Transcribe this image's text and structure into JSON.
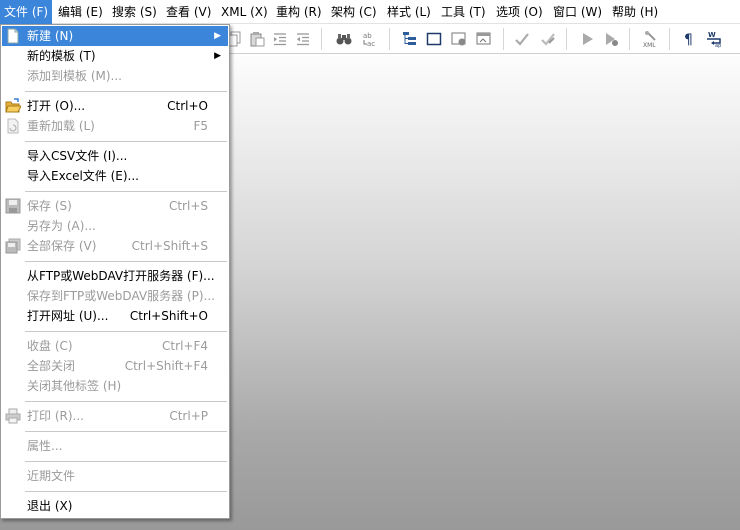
{
  "menubar": {
    "items": [
      "文件 (F)",
      "编辑 (E)",
      "搜索 (S)",
      "查看 (V)",
      "XML (X)",
      "重构 (R)",
      "架构 (C)",
      "样式 (L)",
      "工具 (T)",
      "选项 (O)",
      "窗口 (W)",
      "帮助 (H)"
    ]
  },
  "toolbar": {
    "icons": [
      "copy-icon",
      "paste-icon",
      "indent-icon",
      "outdent-icon",
      "find-icon",
      "replace-icon",
      "tree-view-icon",
      "text-view-icon",
      "grid-view-icon",
      "browser-view-icon",
      "check-wellformed-icon",
      "validate-icon",
      "run-icon",
      "debug-icon",
      "xml-tools-icon",
      "pilcrow-icon",
      "word-wrap-icon"
    ]
  },
  "file_menu": {
    "new": {
      "label": "新建 (N)"
    },
    "new_from_template": {
      "label": "新的模板 (T)"
    },
    "add_to_template": {
      "label": "添加到模板 (M)..."
    },
    "open": {
      "label": "打开 (O)...",
      "shortcut": "Ctrl+O"
    },
    "reload": {
      "label": "重新加载 (L)",
      "shortcut": "F5"
    },
    "import_csv": {
      "label": "导入CSV文件 (I)..."
    },
    "import_excel": {
      "label": "导入Excel文件 (E)..."
    },
    "save": {
      "label": "保存 (S)",
      "shortcut": "Ctrl+S"
    },
    "save_as": {
      "label": "另存为 (A)..."
    },
    "save_all": {
      "label": "全部保存 (V)",
      "shortcut": "Ctrl+Shift+S"
    },
    "open_ftp": {
      "label": "从FTP或WebDAV打开服务器 (F)..."
    },
    "save_ftp": {
      "label": "保存到FTP或WebDAV服务器 (P)..."
    },
    "open_url": {
      "label": "打开网址 (U)...",
      "shortcut": "Ctrl+Shift+O"
    },
    "close": {
      "label": "收盘 (C)",
      "shortcut": "Ctrl+F4"
    },
    "close_all": {
      "label": "全部关闭",
      "shortcut": "Ctrl+Shift+F4"
    },
    "close_other": {
      "label": "关闭其他标签 (H)"
    },
    "print": {
      "label": "打印 (R)...",
      "shortcut": "Ctrl+P"
    },
    "properties": {
      "label": "属性..."
    },
    "recent_files": {
      "label": "近期文件"
    },
    "exit": {
      "label": "退出 (X)"
    }
  }
}
